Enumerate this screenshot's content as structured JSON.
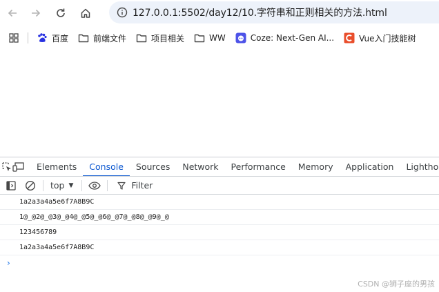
{
  "browser": {
    "url": "127.0.0.1:5502/day12/10.字符串和正则相关的方法.html",
    "bookmarks": [
      {
        "icon": "baidu-icon",
        "label": "百度"
      },
      {
        "icon": "folder-icon",
        "label": "前端文件"
      },
      {
        "icon": "folder-icon",
        "label": "项目相关"
      },
      {
        "icon": "folder-icon",
        "label": "WW"
      },
      {
        "icon": "coze-icon",
        "label": "Coze: Next-Gen AI..."
      },
      {
        "icon": "csdn-icon",
        "label": "Vue入门技能树"
      }
    ]
  },
  "devtools": {
    "tabs": [
      "Elements",
      "Console",
      "Sources",
      "Network",
      "Performance",
      "Memory",
      "Application",
      "Lighthouse"
    ],
    "active_tab": "Console",
    "context": "top",
    "filter_placeholder": "Filter",
    "console_output": [
      "1a2a3a4a5e6f7A8B9C",
      "1@_@2@_@3@_@4@_@5@_@6@_@7@_@8@_@9@_@",
      "123456789",
      "1a2a3a4a5e6f7A8B9C"
    ],
    "prompt_symbol": "›"
  },
  "watermark": "CSDN @狮子座的男孩",
  "colors": {
    "accent": "#0b57d0",
    "omnibox": "#edf2fa",
    "coze": "#4d53e8",
    "csdn": "#e94e2c",
    "baidu": "#2932e1"
  }
}
